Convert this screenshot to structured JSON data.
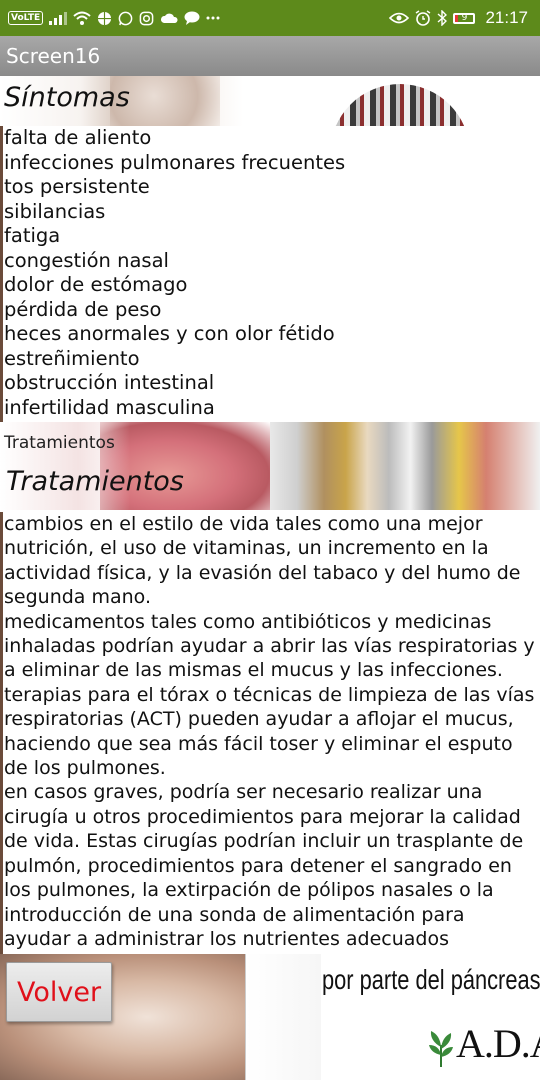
{
  "status_bar": {
    "volte": "VoLTE",
    "battery": "9",
    "time": "21:17",
    "icons_left": [
      "volte-icon",
      "signal-icon",
      "wifi-icon",
      "basketball-icon",
      "whatsapp-icon",
      "instagram-icon",
      "cloud-icon",
      "chat-icon",
      "more-icon"
    ],
    "icons_right": [
      "eye-icon",
      "alarm-icon",
      "bluetooth-icon",
      "battery-icon"
    ]
  },
  "app": {
    "title": "Screen16"
  },
  "sections": {
    "sintomas_title": "Síntomas",
    "symptoms": [
      "falta de aliento",
      "infecciones pulmonares frecuentes",
      "tos persistente",
      "sibilancias",
      "fatiga",
      "congestión nasal",
      "dolor de estómago",
      "pérdida de peso",
      "heces anormales y con olor fétido",
      "estreñimiento",
      "obstrucción intestinal",
      "infertilidad masculina"
    ],
    "tratamientos_small": "Tratamientos",
    "tratamientos_title": "Tratamientos",
    "treatments": [
      "cambios en el estilo de vida tales como una mejor nutrición, el uso de vitaminas, un incremento en la actividad física, y la evasión del tabaco y del humo de segunda mano.",
      "medicamentos tales como antibióticos y medicinas inhaladas podrían ayudar a abrir las vías respiratorias y a eliminar de las mismas el mucus y las infecciones.",
      "terapias para el tórax o técnicas de limpieza de las vías respiratorias (ACT) pueden ayudar a aflojar el mucus, haciendo que sea más fácil toser y eliminar el esputo de los pulmones.",
      "en casos graves, podría ser necesario realizar una cirugía u otros procedimientos para mejorar la calidad de vida. Estas cirugías podrían incluir un trasplante de pulmón, procedimientos para detener el sangrado en los pulmones, la extirpación de pólipos nasales o la introducción de una sonda de alimentación para ayudar a administrar los nutrientes adecuados"
    ]
  },
  "footer": {
    "back_button": "Volver",
    "image_caption": "por parte del páncreas",
    "logo_text": "A.D.A.M."
  },
  "colors": {
    "status_bar": "#5d8a1b",
    "title_bar": "#999999",
    "button_text": "#e0101a"
  }
}
